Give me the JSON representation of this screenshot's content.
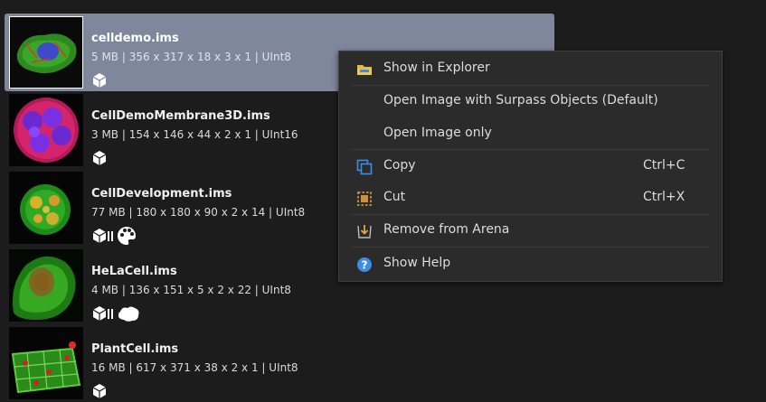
{
  "files": [
    {
      "name": "celldemo.ims",
      "meta": "5 MB | 356 x 317 x 18 x 3 x 1 | UInt8",
      "icons": [
        "cube-icon"
      ]
    },
    {
      "name": "CellDemoMembrane3D.ims",
      "meta": "3 MB | 154 x 146 x 44 x 2 x 1 | UInt16",
      "icons": [
        "cube-icon"
      ]
    },
    {
      "name": "CellDevelopment.ims",
      "meta": "77 MB | 180 x 180 x 90 x 2 x 14 | UInt8",
      "icons": [
        "film-cube-icon",
        "palette-icon"
      ]
    },
    {
      "name": "HeLaCell.ims",
      "meta": "4 MB | 136 x 151 x 5 x 2 x 22 | UInt8",
      "icons": [
        "film-cube-icon",
        "blob-icon"
      ]
    },
    {
      "name": "PlantCell.ims",
      "meta": "16 MB | 617 x 371 x 38 x 2 x 1 | UInt8",
      "icons": [
        "cube-icon"
      ]
    }
  ],
  "menu": {
    "show_in_explorer": "Show in Explorer",
    "open_with_surpass": "Open Image with Surpass Objects (Default)",
    "open_only": "Open Image only",
    "copy": "Copy",
    "copy_shortcut": "Ctrl+C",
    "cut": "Cut",
    "cut_shortcut": "Ctrl+X",
    "remove": "Remove from Arena",
    "help": "Show Help"
  },
  "colors": {
    "selection": "#7f879d",
    "menu_bg": "#2b2b2b",
    "accent_blue": "#3a8ee6",
    "accent_orange": "#e8a33a"
  }
}
